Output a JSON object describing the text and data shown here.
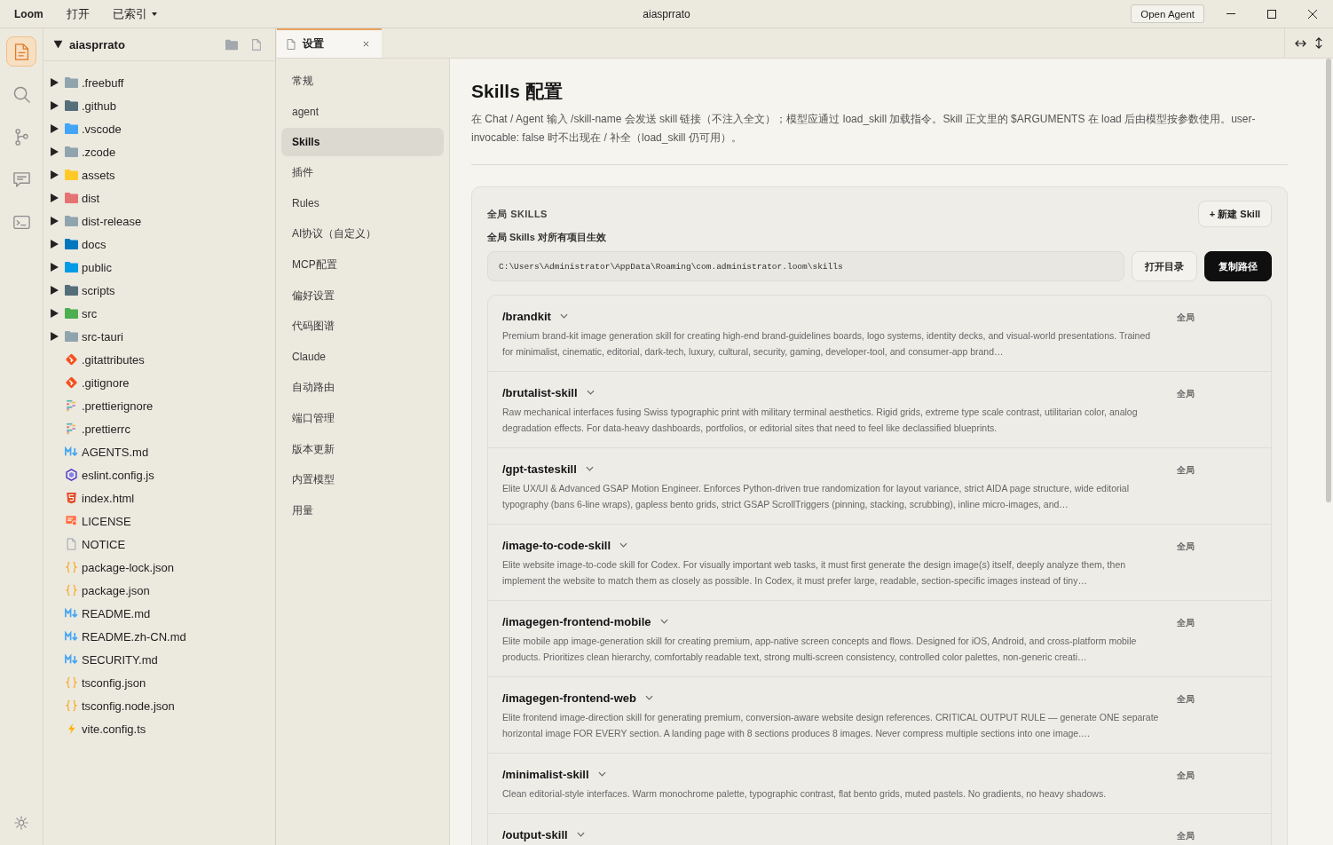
{
  "title_bar": {
    "app_name": "Loom",
    "menus": [
      {
        "label": "打开",
        "dropdown": false
      },
      {
        "label": "已索引",
        "dropdown": true
      }
    ],
    "title": "aiasprrato",
    "button": "Open Agent"
  },
  "activity_bar": {
    "items": [
      {
        "kind": "files",
        "selected": true
      },
      {
        "kind": "search",
        "selected": false
      },
      {
        "kind": "source-control",
        "selected": false
      },
      {
        "kind": "chat",
        "selected": false
      },
      {
        "kind": "terminal",
        "selected": false
      }
    ],
    "bottom_items": [
      {
        "kind": "theme"
      }
    ]
  },
  "explorer": {
    "root": {
      "label": "aiasprrato",
      "expanded": true
    },
    "items": [
      {
        "label": ".freebuff",
        "kind": "folder",
        "color": "#90a4ae",
        "expanded": false
      },
      {
        "label": ".github",
        "kind": "folder",
        "color": "#546e7a",
        "expanded": false
      },
      {
        "label": ".vscode",
        "kind": "folder",
        "color": "#42a5f5",
        "expanded": false
      },
      {
        "label": ".zcode",
        "kind": "folder",
        "color": "#90a4ae",
        "expanded": false
      },
      {
        "label": "assets",
        "kind": "folder",
        "color": "#ffca28",
        "expanded": false
      },
      {
        "label": "dist",
        "kind": "folder",
        "color": "#e57373",
        "expanded": false
      },
      {
        "label": "dist-release",
        "kind": "folder",
        "color": "#90a4ae",
        "expanded": false
      },
      {
        "label": "docs",
        "kind": "folder",
        "color": "#0277bd",
        "expanded": false
      },
      {
        "label": "public",
        "kind": "folder",
        "color": "#039be5",
        "expanded": false
      },
      {
        "label": "scripts",
        "kind": "folder",
        "color": "#546e7a",
        "expanded": false
      },
      {
        "label": "src",
        "kind": "folder",
        "color": "#4caf50",
        "expanded": false
      },
      {
        "label": "src-tauri",
        "kind": "folder",
        "color": "#90a4ae",
        "expanded": false
      },
      {
        "label": ".gitattributes",
        "kind": "git"
      },
      {
        "label": ".gitignore",
        "kind": "git"
      },
      {
        "label": ".prettierignore",
        "kind": "prettier"
      },
      {
        "label": ".prettierrc",
        "kind": "prettier"
      },
      {
        "label": "AGENTS.md",
        "kind": "markdown"
      },
      {
        "label": "eslint.config.js",
        "kind": "eslint"
      },
      {
        "label": "index.html",
        "kind": "html"
      },
      {
        "label": "LICENSE",
        "kind": "license"
      },
      {
        "label": "NOTICE",
        "kind": "text"
      },
      {
        "label": "package-lock.json",
        "kind": "json"
      },
      {
        "label": "package.json",
        "kind": "json"
      },
      {
        "label": "README.md",
        "kind": "markdown"
      },
      {
        "label": "README.zh-CN.md",
        "kind": "markdown"
      },
      {
        "label": "SECURITY.md",
        "kind": "markdown"
      },
      {
        "label": "tsconfig.json",
        "kind": "json"
      },
      {
        "label": "tsconfig.node.json",
        "kind": "json"
      },
      {
        "label": "vite.config.ts",
        "kind": "vite"
      }
    ]
  },
  "editor": {
    "tabs": [
      {
        "label": "设置",
        "selected": true
      }
    ]
  },
  "settings": {
    "nav": [
      {
        "label": "常规",
        "selected": false
      },
      {
        "label": "agent",
        "selected": false
      },
      {
        "label": "Skills",
        "selected": true
      },
      {
        "label": "插件",
        "selected": false
      },
      {
        "label": "Rules",
        "selected": false
      },
      {
        "label": "AI协议（自定义）",
        "selected": false
      },
      {
        "label": "MCP配置",
        "selected": false
      },
      {
        "label": "偏好设置",
        "selected": false
      },
      {
        "label": "代码图谱",
        "selected": false
      },
      {
        "label": "Claude",
        "selected": false
      },
      {
        "label": "自动路由",
        "selected": false
      },
      {
        "label": "端口管理",
        "selected": false
      },
      {
        "label": "版本更新",
        "selected": false
      },
      {
        "label": "内置模型",
        "selected": false
      },
      {
        "label": "用量",
        "selected": false
      }
    ],
    "title": "Skills 配置",
    "description": "在 Chat / Agent 输入 /skill-name 会发送 skill 链接（不注入全文）；模型应通过 load_skill 加载指令。Skill 正文里的 $ARGUMENTS 在 load 后由模型按参数使用。user-invocable: false 时不出现在 / 补全（load_skill 仍可用）。",
    "global_section": {
      "label": "全局 SKILLS",
      "new_button": "+ 新建 Skill",
      "subtitle": "全局 Skills 对所有项目生效",
      "path": "C:\\Users\\Administrator\\AppData\\Roaming\\com.administrator.loom\\skills",
      "buttons": [
        {
          "label": "打开目录",
          "kind": "secondary"
        },
        {
          "label": "复制路径",
          "kind": "primary"
        }
      ]
    },
    "skills": [
      {
        "name": "/brandkit",
        "scope": "全局",
        "description": "Premium brand-kit image generation skill for creating high-end brand-guidelines boards, logo systems, identity decks, and visual-world presentations. Trained for minimalist, cinematic, editorial, dark-tech, luxury, cultural, security, gaming, developer-tool, and consumer-app brand…"
      },
      {
        "name": "/brutalist-skill",
        "scope": "全局",
        "description": "Raw mechanical interfaces fusing Swiss typographic print with military terminal aesthetics. Rigid grids, extreme type scale contrast, utilitarian color, analog degradation effects. For data-heavy dashboards, portfolios, or editorial sites that need to feel like declassified blueprints."
      },
      {
        "name": "/gpt-tasteskill",
        "scope": "全局",
        "description": "Elite UX/UI & Advanced GSAP Motion Engineer. Enforces Python-driven true randomization for layout variance, strict AIDA page structure, wide editorial typography (bans 6-line wraps), gapless bento grids, strict GSAP ScrollTriggers (pinning, stacking, scrubbing), inline micro-images, and…"
      },
      {
        "name": "/image-to-code-skill",
        "scope": "全局",
        "description": "Elite website image-to-code skill for Codex. For visually important web tasks, it must first generate the design image(s) itself, deeply analyze them, then implement the website to match them as closely as possible. In Codex, it must prefer large, readable, section-specific images instead of tiny…"
      },
      {
        "name": "/imagegen-frontend-mobile",
        "scope": "全局",
        "description": "Elite mobile app image-generation skill for creating premium, app-native screen concepts and flows. Designed for iOS, Android, and cross-platform mobile products. Prioritizes clean hierarchy, comfortably readable text, strong multi-screen consistency, controlled color palettes, non-generic creati…"
      },
      {
        "name": "/imagegen-frontend-web",
        "scope": "全局",
        "description": "Elite frontend image-direction skill for generating premium, conversion-aware website design references. CRITICAL OUTPUT RULE — generate ONE separate horizontal image FOR EVERY section. A landing page with 8 sections produces 8 images. Never compress multiple sections into one image.…"
      },
      {
        "name": "/minimalist-skill",
        "scope": "全局",
        "description": "Clean editorial-style interfaces. Warm monochrome palette, typographic contrast, flat bento grids, muted pastels. No gradients, no heavy shadows."
      },
      {
        "name": "/output-skill",
        "scope": "全局"
      }
    ]
  }
}
